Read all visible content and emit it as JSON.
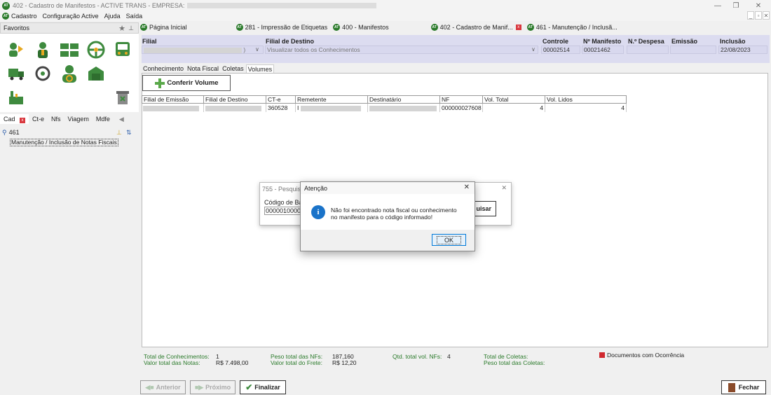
{
  "window": {
    "title": "402 - Cadastro de Manifestos - ACTIVE TRANS - EMPRESA:"
  },
  "menu": [
    "Cadastro",
    "Configuração Active",
    "Ajuda",
    "Saída"
  ],
  "favorites": {
    "title": "Favoritos"
  },
  "left_tabs": [
    "Cad",
    "Ct-e",
    "Nfs",
    "Viagem",
    "Mdfe"
  ],
  "search": {
    "value": "461"
  },
  "tree": {
    "item": "Manutenção / Inclusão de Notas Fiscais"
  },
  "doc_tabs": [
    "Página Inicial",
    "281 - Impressão de Etiquetas",
    "400 - Manifestos",
    "402 - Cadastro de Manif...",
    "461 - Manutenção / Inclusã..."
  ],
  "header": {
    "filial_label": "Filial",
    "filial_destino_label": "Filial de Destino",
    "filial_destino_value": "Visualizar todos os Conhecimentos",
    "controle_label": "Controle",
    "controle_value": "00002514",
    "manifesto_label": "Nº Manifesto",
    "manifesto_value": "00021462",
    "despesa_label": "N.º Despesa",
    "emissao_label": "Emissão",
    "inclusao_label": "Inclusão",
    "inclusao_value": "22/08/2023"
  },
  "subtabs": [
    "Conhecimento",
    "Nota Fiscal",
    "Coletas",
    "Volumes"
  ],
  "conferir_button": "Conferir Volume",
  "grid": {
    "columns": [
      "Filial de Emissão",
      "Filial de Destino",
      "CT-e",
      "Remetente",
      "Destinatário",
      "NF",
      "Vol. Total",
      "Vol. Lidos"
    ],
    "rows": [
      {
        "cte": "360528",
        "remetente": "I",
        "nf": "000000027608",
        "vol_total": "4",
        "vol_lidos": "4"
      }
    ]
  },
  "footer": {
    "total_conhec_label": "Total de Conhecimentos:",
    "total_conhec_value": "1",
    "valor_notas_label": "Valor total das Notas:",
    "valor_notas_value": "R$ 7.498,00",
    "peso_nfs_label": "Peso total das NFs:",
    "peso_nfs_value": "187,160",
    "valor_frete_label": "Valor total do Frete:",
    "valor_frete_value": "R$ 12,20",
    "qtd_vol_label": "Qtd. total vol. NFs:",
    "qtd_vol_value": "4",
    "total_coletas_label": "Total de Coletas:",
    "peso_coletas_label": "Peso total das Coletas:",
    "legend_label": "Documentos com Ocorrência"
  },
  "buttons": {
    "anterior": "Anterior",
    "proximo": "Próximo",
    "finalizar": "Finalizar",
    "fechar": "Fechar"
  },
  "back_dialog": {
    "title": "755 - Pesquisa",
    "label": "Código de Ba",
    "value": "00000100000",
    "button": "uisar"
  },
  "alert": {
    "title": "Atenção",
    "message": "Não foi encontrado nota fiscal ou conhecimento no manifesto para o código informado!",
    "ok": "OK"
  },
  "colors": {
    "accent_green": "#2a7a2a",
    "header_bg": "#dcdcf0",
    "ocorrencia": "#d0282e"
  }
}
